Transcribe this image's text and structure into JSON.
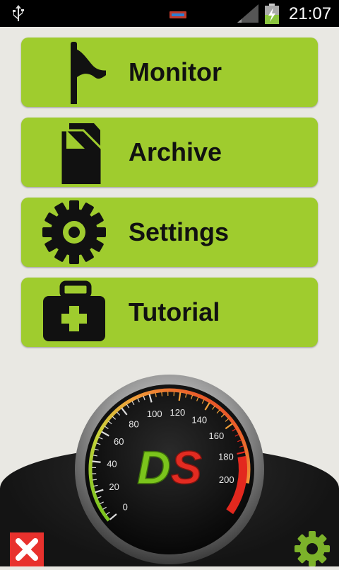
{
  "status_bar": {
    "time": "21:07"
  },
  "menu": [
    {
      "label": "Monitor",
      "icon": "flag-icon"
    },
    {
      "label": "Archive",
      "icon": "documents-icon"
    },
    {
      "label": "Settings",
      "icon": "gear-icon"
    },
    {
      "label": "Tutorial",
      "icon": "first-aid-kit-icon"
    }
  ],
  "gauge": {
    "logo": "DS",
    "ticks": [
      "0",
      "20",
      "40",
      "60",
      "80",
      "100",
      "120",
      "140",
      "160",
      "180",
      "200"
    ]
  },
  "colors": {
    "accent": "#9fcc2e",
    "close": "#e8312d",
    "logo_green": "#7bc41c",
    "logo_red": "#e32b21"
  }
}
